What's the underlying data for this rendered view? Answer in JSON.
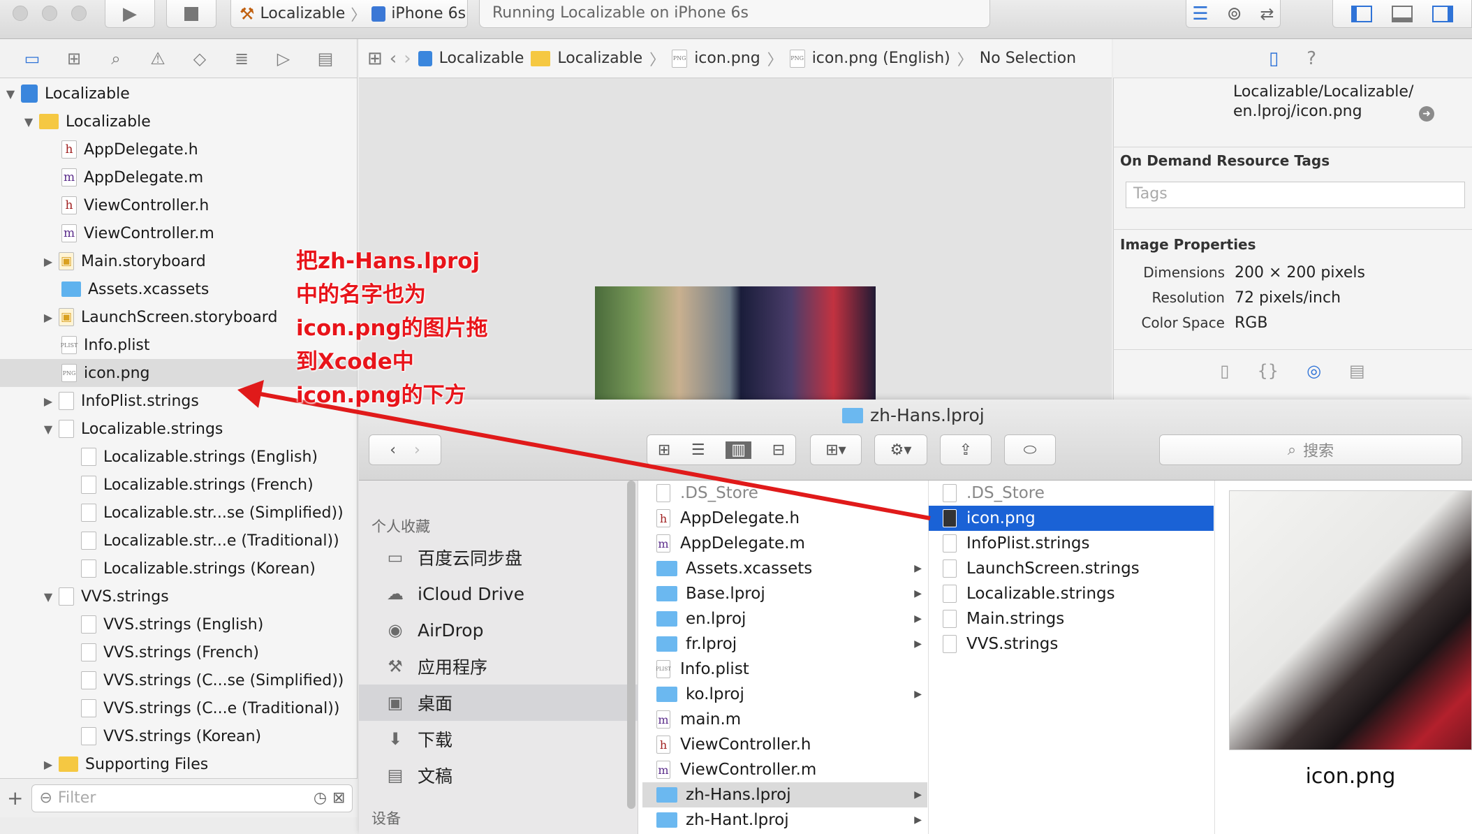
{
  "toolbar": {
    "scheme_project": "Localizable",
    "scheme_device": "iPhone 6s",
    "activity_status": "Running Localizable on iPhone 6s"
  },
  "navigator": {
    "rows": [
      {
        "label": "Localizable",
        "kind": "project"
      },
      {
        "label": "Localizable",
        "kind": "folder"
      },
      {
        "label": "AppDelegate.h",
        "kind": "h"
      },
      {
        "label": "AppDelegate.m",
        "kind": "m"
      },
      {
        "label": "ViewController.h",
        "kind": "h"
      },
      {
        "label": "ViewController.m",
        "kind": "m"
      },
      {
        "label": "Main.storyboard",
        "kind": "storyboard"
      },
      {
        "label": "Assets.xcassets",
        "kind": "assets"
      },
      {
        "label": "LaunchScreen.storyboard",
        "kind": "storyboard"
      },
      {
        "label": "Info.plist",
        "kind": "plist"
      },
      {
        "label": "icon.png",
        "kind": "png"
      },
      {
        "label": "InfoPlist.strings",
        "kind": "strings"
      },
      {
        "label": "Localizable.strings",
        "kind": "strings"
      },
      {
        "label": "Localizable.strings (English)",
        "kind": "strings"
      },
      {
        "label": "Localizable.strings (French)",
        "kind": "strings"
      },
      {
        "label": "Localizable.str...se (Simplified))",
        "kind": "strings"
      },
      {
        "label": "Localizable.str...e (Traditional))",
        "kind": "strings"
      },
      {
        "label": "Localizable.strings (Korean)",
        "kind": "strings"
      },
      {
        "label": "VVS.strings",
        "kind": "strings"
      },
      {
        "label": "VVS.strings (English)",
        "kind": "strings"
      },
      {
        "label": "VVS.strings (French)",
        "kind": "strings"
      },
      {
        "label": "VVS.strings (C...se (Simplified))",
        "kind": "strings"
      },
      {
        "label": "VVS.strings (C...e (Traditional))",
        "kind": "strings"
      },
      {
        "label": "VVS.strings (Korean)",
        "kind": "strings"
      },
      {
        "label": "Supporting Files",
        "kind": "folder"
      }
    ],
    "filter_placeholder": "Filter"
  },
  "jumpbar": {
    "items": [
      "Localizable",
      "Localizable",
      "icon.png",
      "icon.png (English)",
      "No Selection"
    ]
  },
  "inspector": {
    "full_path_line1": "Localizable/Localizable/",
    "full_path_line2": "en.lproj/icon.png",
    "on_demand_title": "On Demand Resource Tags",
    "tags_placeholder": "Tags",
    "image_props_title": "Image Properties",
    "dimensions_label": "Dimensions",
    "dimensions_value": "200 × 200 pixels",
    "resolution_label": "Resolution",
    "resolution_value": "72 pixels/inch",
    "colorspace_label": "Color Space",
    "colorspace_value": "RGB"
  },
  "finder": {
    "title": "zh-Hans.lproj",
    "search_placeholder": "搜索",
    "favorites_heading": "个人收藏",
    "devices_heading": "设备",
    "sidebar": [
      "百度云同步盘",
      "iCloud Drive",
      "AirDrop",
      "应用程序",
      "桌面",
      "下载",
      "文稿"
    ],
    "column1": [
      {
        "label": ".DS_Store",
        "kind": "blank"
      },
      {
        "label": "AppDelegate.h",
        "kind": "h"
      },
      {
        "label": "AppDelegate.m",
        "kind": "m"
      },
      {
        "label": "Assets.xcassets",
        "kind": "folder"
      },
      {
        "label": "Base.lproj",
        "kind": "folder"
      },
      {
        "label": "en.lproj",
        "kind": "folder"
      },
      {
        "label": "fr.lproj",
        "kind": "folder"
      },
      {
        "label": "Info.plist",
        "kind": "plist"
      },
      {
        "label": "ko.lproj",
        "kind": "folder"
      },
      {
        "label": "main.m",
        "kind": "m"
      },
      {
        "label": "ViewController.h",
        "kind": "h"
      },
      {
        "label": "ViewController.m",
        "kind": "m"
      },
      {
        "label": "zh-Hans.lproj",
        "kind": "folder"
      },
      {
        "label": "zh-Hant.lproj",
        "kind": "folder"
      }
    ],
    "column2": [
      ".DS_Store",
      "icon.png",
      "InfoPlist.strings",
      "LaunchScreen.strings",
      "Localizable.strings",
      "Main.strings",
      "VVS.strings"
    ],
    "preview_name": "icon.png"
  },
  "annotation": {
    "line1": "把zh-Hans.lproj",
    "line2": "中的名字也为",
    "line3": "icon.png的图片拖",
    "line4": "到Xcode中",
    "line5": "icon.png的下方"
  }
}
